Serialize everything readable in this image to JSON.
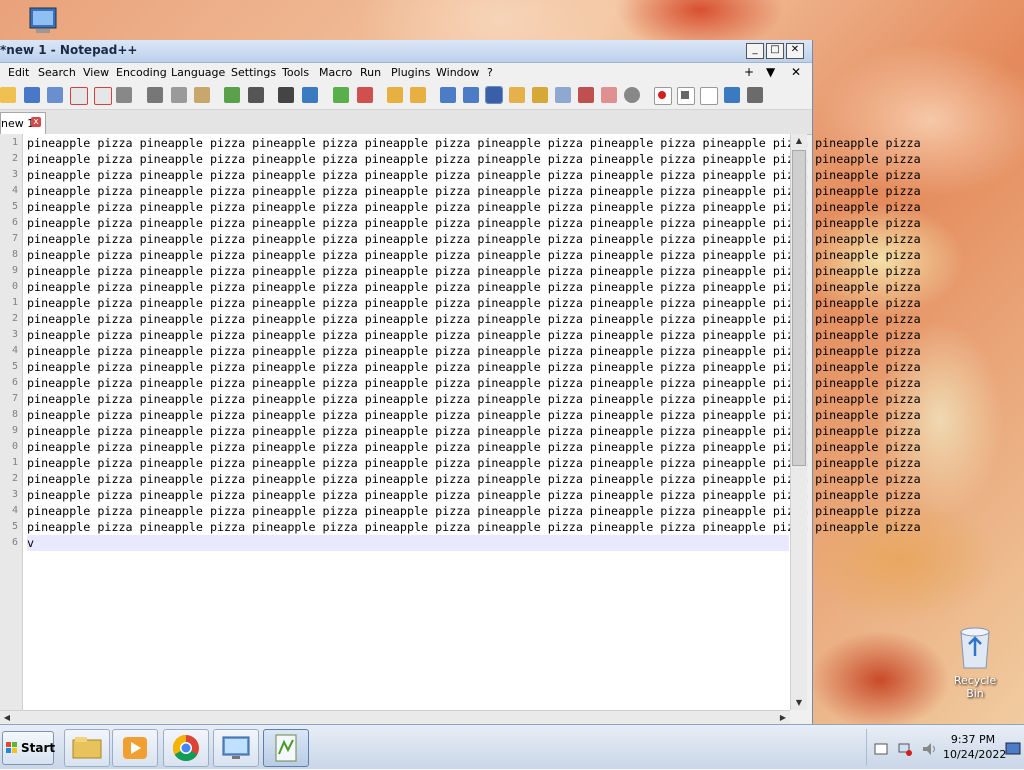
{
  "window": {
    "title": "*new 1 - Notepad++",
    "controls": {
      "minimize": "_",
      "maximize": "□",
      "close": "✕"
    }
  },
  "menu": {
    "items": [
      "Edit",
      "Search",
      "View",
      "Encoding",
      "Language",
      "Settings",
      "Tools",
      "Macro",
      "Run",
      "Plugins",
      "Window",
      "?"
    ],
    "right": {
      "plus": "+",
      "dropdown": "▼",
      "close": "✕"
    }
  },
  "tab": {
    "label": "new 1",
    "close": "x"
  },
  "editor": {
    "line_numbers": [
      "1",
      "2",
      "3",
      "4",
      "5",
      "6",
      "7",
      "8",
      "9",
      "0",
      "1",
      "2",
      "3",
      "4",
      "5",
      "6",
      "7",
      "8",
      "9",
      "0",
      "1",
      "2",
      "3",
      "4",
      "5",
      "6"
    ],
    "repeated_text": "pineapple pizza pineapple pizza pineapple pizza pineapple pizza pineapple pizza pineapple pizza pineapple pizza pineapple pizza",
    "last_line": "v"
  },
  "desktop": {
    "recycle_bin_label": "Recycle Bin",
    "colors": {
      "accent_titlebar": "#bcd0ec",
      "current_line": "#e8e8ff"
    }
  },
  "taskbar": {
    "start_label": "Start",
    "clock_time": "9:37 PM",
    "clock_date": "10/24/2022",
    "buttons": [
      "file-explorer-icon",
      "media-player-icon",
      "chrome-icon",
      "remote-desktop-icon",
      "notepadpp-icon"
    ]
  }
}
